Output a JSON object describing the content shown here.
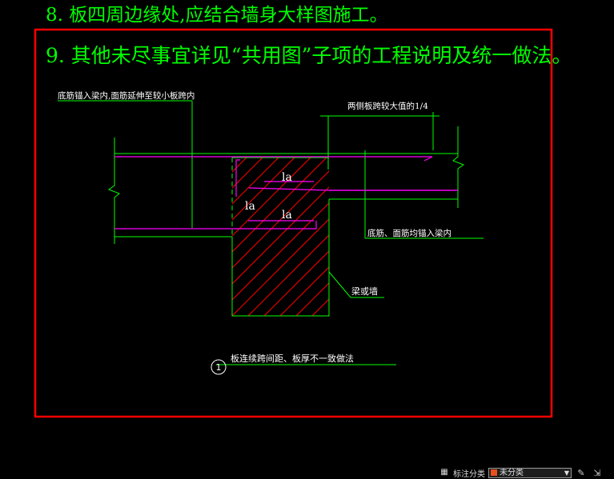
{
  "notes": {
    "note8": "8. 板四周边缘处,应结合墙身大样图施工。",
    "note9": "9. 其他未尽事宜详见“共用图”子项的工程说明及统一做法。"
  },
  "drawing": {
    "callout_left": "底筋锚入梁内,面筋延伸至较小板跨内",
    "callout_top_right": "两侧板跨较大值的1/4",
    "callout_right": "底筋、面筋均锚入梁内",
    "callout_beam": "梁或墙",
    "la_label": "la",
    "detail_number": "1",
    "detail_title": "板连续跨间距、板厚不一致做法"
  },
  "statusbar": {
    "icon": "grid-icon",
    "annotation_label": "标注分类",
    "category_value": "未分类",
    "category_color": "#e8501e"
  },
  "colors": {
    "frame": "#ff0000",
    "note_text": "#00ff00",
    "line": "#00ff00",
    "rebar": "#ff00ff",
    "hatch": "#ff0000",
    "text_white": "#ffffff"
  }
}
